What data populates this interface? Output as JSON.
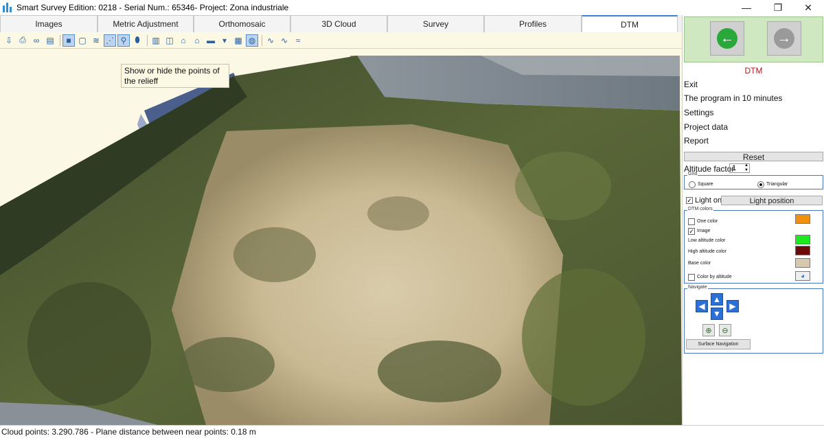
{
  "window": {
    "title": "Smart Survey  Edition: 0218 - Serial Num.: 65346- Project: Zona industriale",
    "minimize": "—",
    "restore": "❐",
    "close": "✕"
  },
  "tabs": [
    {
      "label": "Images"
    },
    {
      "label": "Metric Adjustment"
    },
    {
      "label": "Orthomosaic"
    },
    {
      "label": "3D Cloud"
    },
    {
      "label": "Survey"
    },
    {
      "label": "Profiles"
    },
    {
      "label": "DTM",
      "active": true
    }
  ],
  "toolbar": {
    "icons": [
      "import-icon",
      "print-icon",
      "binoculars-icon",
      "export-dxf-icon",
      "solid-view-icon",
      "wireframe-view-icon",
      "contour-icon",
      "relief-points-icon",
      "zoom-lens-icon",
      "marker-icon",
      "panel-left-icon",
      "panel-split-icon",
      "home-icon",
      "house-outline-icon",
      "layers-icon",
      "dropdown-view-icon",
      "texture-icon",
      "globe-icon",
      "profile-line-1-icon",
      "profile-line-2-icon",
      "profile-line-3-icon"
    ]
  },
  "tooltip": {
    "text": "Show or hide the points of the relieff"
  },
  "panel": {
    "back_arrow": "←",
    "forward_arrow": "→",
    "title": "DTM",
    "menu": [
      "Exit",
      "The program in 10 minutes",
      "Settings",
      "Project data",
      "Report"
    ],
    "reset_label": "Reset",
    "altitude_label": "Altitude factor",
    "altitude_value": "1",
    "grid": {
      "label": "Grid",
      "square": "Square",
      "triangular": "Triangular",
      "selected": "Triangular"
    },
    "light": {
      "label": "Light on",
      "checked": true,
      "position_button": "Light position"
    },
    "dtm_colors": {
      "label": "DTM colors",
      "one_color": "One color",
      "image": "Image",
      "low": "Low altitude color",
      "high": "High altitude color",
      "base": "Base color",
      "by_altitude": "Color by altitude",
      "colors": {
        "one": "#f0900e",
        "low": "#1ee81e",
        "high": "#6a0a0a",
        "base": "#d6c9b0"
      }
    },
    "navigate": {
      "label": "Navigate",
      "surface_button": "Surface Navigation"
    }
  },
  "status": {
    "text": "Cloud points: 3.290.786 - Plane distance between near points: 0.18 m"
  }
}
